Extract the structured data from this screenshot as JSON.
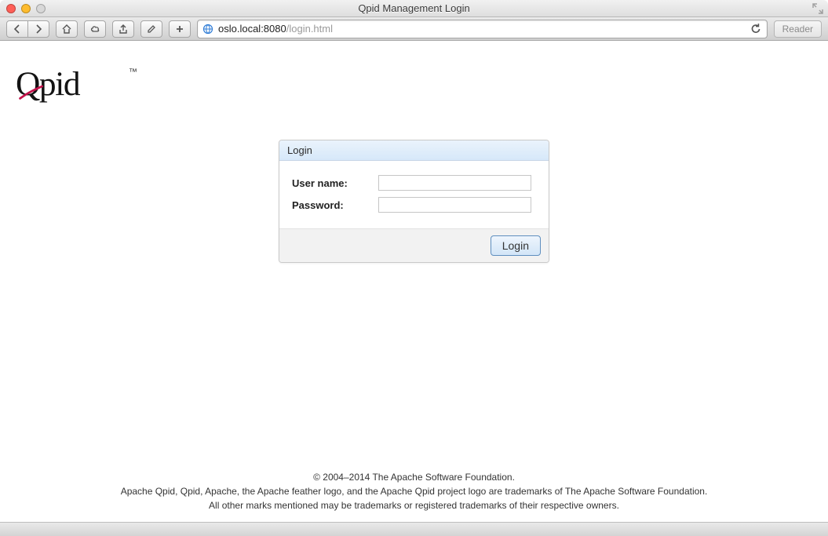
{
  "window": {
    "title": "Qpid Management Login"
  },
  "url": {
    "host": "oslo.local:8080",
    "path": "/login.html"
  },
  "toolbar": {
    "reader_label": "Reader"
  },
  "logo": {
    "tm": "™"
  },
  "login": {
    "panel_title": "Login",
    "username_label": "User name:",
    "password_label": "Password:",
    "username_value": "",
    "password_value": "",
    "button_label": "Login"
  },
  "footer": {
    "line1": "© 2004–2014 The Apache Software Foundation.",
    "line2": "Apache Qpid, Qpid, Apache, the Apache feather logo, and the Apache Qpid project logo are trademarks of The Apache Software Foundation.",
    "line3": "All other marks mentioned may be trademarks or registered trademarks of their respective owners."
  }
}
